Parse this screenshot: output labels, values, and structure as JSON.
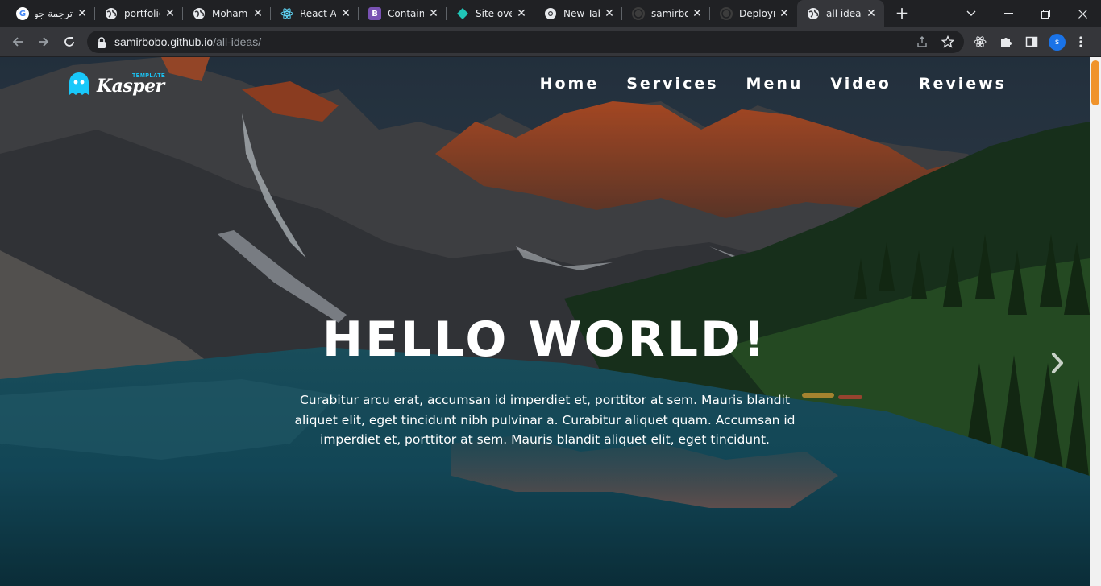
{
  "browser": {
    "tabs": [
      {
        "title": "ترجمة جو",
        "icon": "google-icon",
        "active": false
      },
      {
        "title": "portfolio",
        "icon": "globe-icon",
        "active": false
      },
      {
        "title": "Moham",
        "icon": "globe-icon",
        "active": false
      },
      {
        "title": "React Ap",
        "icon": "react-icon",
        "active": false
      },
      {
        "title": "Containe",
        "icon": "bootstrap-icon",
        "active": false
      },
      {
        "title": "Site over",
        "icon": "netlify-icon",
        "active": false
      },
      {
        "title": "New Tab",
        "icon": "chrome-icon",
        "active": false
      },
      {
        "title": "samirbo",
        "icon": "github-icon",
        "active": false
      },
      {
        "title": "Deploym",
        "icon": "github-icon",
        "active": false
      },
      {
        "title": "all ideas",
        "icon": "globe-icon",
        "active": true
      }
    ],
    "url_host": "samirbobo.github.io",
    "url_path": "/all-ideas/",
    "profile_initial": "s"
  },
  "site": {
    "logo_text": "Kasper",
    "logo_tag": "TEMPLATE",
    "nav": [
      "Home",
      "Services",
      "Menu",
      "Video",
      "Reviews"
    ],
    "hero_title": "HELLO WORLD!",
    "hero_text": "Curabitur arcu erat, accumsan id imperdiet et, porttitor at sem. Mauris blandit aliquet elit, eget tincidunt nibh pulvinar a. Curabitur aliquet quam. Accumsan id imperdiet et, porttitor at sem. Mauris blandit aliquet elit, eget tincidunt."
  },
  "colors": {
    "accent": "#19c8fa",
    "scroll_thumb": "#f0932b",
    "chrome_dark": "#202124",
    "chrome_toolbar": "#35363a"
  }
}
